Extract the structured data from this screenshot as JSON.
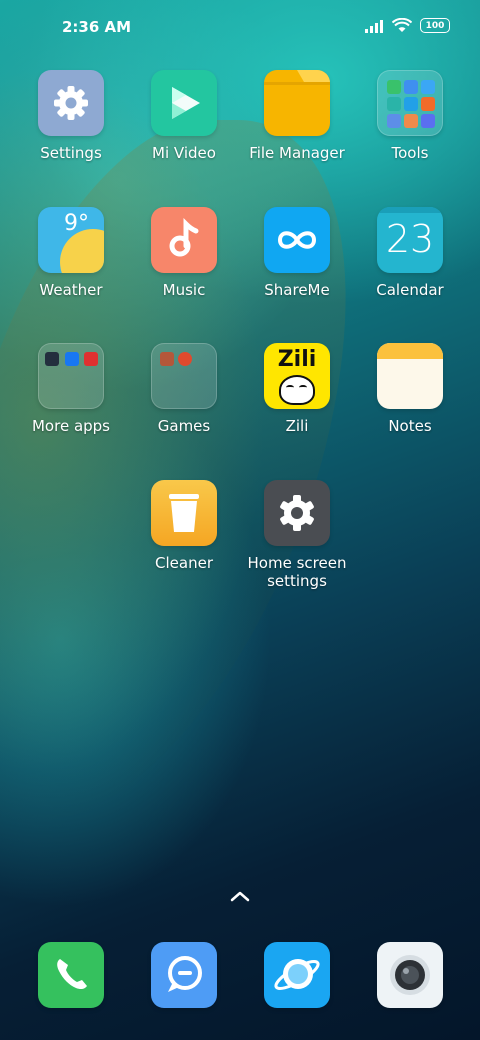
{
  "status_bar": {
    "time": "2:36 AM",
    "battery": "100"
  },
  "apps": [
    {
      "name": "Settings"
    },
    {
      "name": "Mi Video"
    },
    {
      "name": "File Manager"
    },
    {
      "name": "Tools"
    },
    {
      "name": "Weather",
      "temp": "9°"
    },
    {
      "name": "Music"
    },
    {
      "name": "ShareMe"
    },
    {
      "name": "Calendar",
      "day": "23"
    },
    {
      "name": "More apps"
    },
    {
      "name": "Games"
    },
    {
      "name": "Zili",
      "logo_text": "Zili"
    },
    {
      "name": "Notes"
    },
    {
      "name": "Cleaner"
    },
    {
      "name": "Home screen settings"
    }
  ],
  "dock": [
    {
      "icon": "phone-icon"
    },
    {
      "icon": "messages-icon"
    },
    {
      "icon": "browser-icon"
    },
    {
      "icon": "camera-icon"
    }
  ],
  "colors": {
    "settings": "#8ea9d2",
    "mivideo": "#23c6a0",
    "filemanager": "#f7b500",
    "music": "#f7866a",
    "shareme": "#10a7f2",
    "calendar": "#24b5cf",
    "zili": "#ffe600",
    "cleaner": "#f7b42a",
    "phone": "#35c15e",
    "messages": "#4e9cf5",
    "browser": "#1aa6f2"
  }
}
